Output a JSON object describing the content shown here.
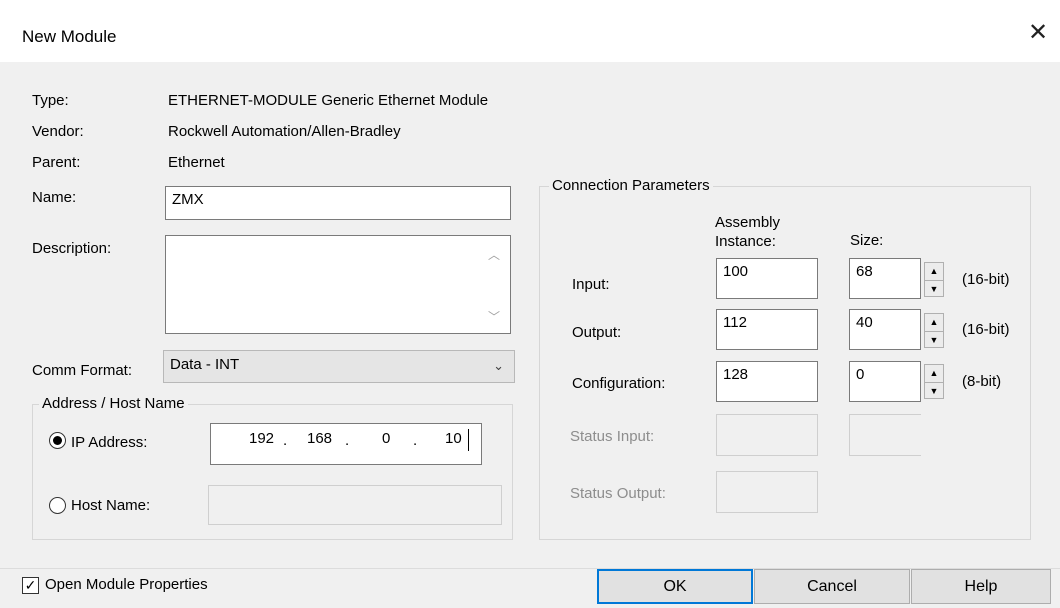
{
  "window": {
    "title": "New Module",
    "close_glyph": "✕"
  },
  "info": {
    "type_label": "Type:",
    "type_value": "ETHERNET-MODULE Generic Ethernet Module",
    "vendor_label": "Vendor:",
    "vendor_value": "Rockwell Automation/Allen-Bradley",
    "parent_label": "Parent:",
    "parent_value": "Ethernet"
  },
  "name": {
    "label": "Name:",
    "value": "ZMX"
  },
  "description": {
    "label": "Description:",
    "value": ""
  },
  "comm_format": {
    "label": "Comm Format:",
    "value": "Data - INT"
  },
  "address": {
    "group_label": "Address / Host Name",
    "ip_label": "IP Address:",
    "ip_octets": [
      "192",
      "168",
      "0",
      "10"
    ],
    "host_label": "Host Name:",
    "host_value": "",
    "selected": "ip"
  },
  "connection": {
    "group_label": "Connection Parameters",
    "col_assembly": "Assembly Instance:",
    "col_size": "Size:",
    "rows": [
      {
        "label": "Input:",
        "instance": "100",
        "size": "68",
        "unit": "(16-bit)"
      },
      {
        "label": "Output:",
        "instance": "112",
        "size": "40",
        "unit": "(16-bit)"
      },
      {
        "label": "Configuration:",
        "instance": "128",
        "size": "0",
        "unit": "(8-bit)"
      }
    ],
    "status_input_label": "Status Input:",
    "status_output_label": "Status Output:"
  },
  "footer": {
    "open_props_label": "Open Module Properties",
    "open_props_checked": true,
    "ok": "OK",
    "cancel": "Cancel",
    "help": "Help"
  },
  "colors": {
    "default_button_border": "#0078d7",
    "window_bg": "#f0f0f0"
  },
  "icons": {
    "close": "close-icon",
    "dropdown": "chevron-down-icon",
    "spin_up": "spin-up-icon",
    "spin_down": "spin-down-icon"
  }
}
